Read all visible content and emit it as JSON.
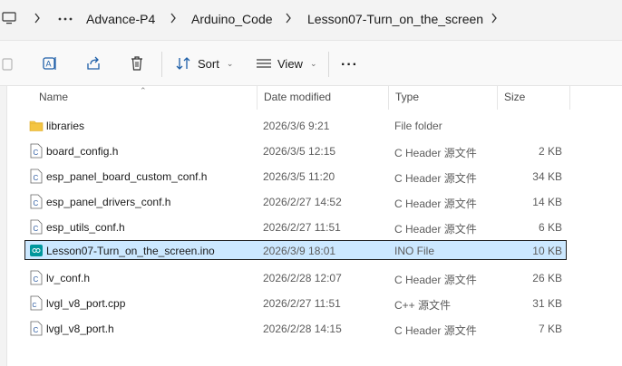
{
  "breadcrumbs": [
    "Advance-P4",
    "Arduino_Code",
    "Lesson07-Turn_on_the_screen"
  ],
  "toolbar": {
    "sort_label": "Sort",
    "view_label": "View",
    "icons": [
      "copy-icon",
      "rename-icon",
      "share-icon",
      "delete-icon",
      "sort-icon",
      "view-icon",
      "more-icon"
    ]
  },
  "columns": {
    "name": "Name",
    "date": "Date modified",
    "type": "Type",
    "size": "Size"
  },
  "files": [
    {
      "name": "libraries",
      "date": "2026/3/6 9:21",
      "type": "File folder",
      "size": "",
      "icon": "folder-icon",
      "selected": false
    },
    {
      "name": "board_config.h",
      "date": "2026/3/5 12:15",
      "type": "C Header 源文件",
      "size": "2 KB",
      "icon": "c-header-file-icon",
      "selected": false
    },
    {
      "name": "esp_panel_board_custom_conf.h",
      "date": "2026/3/5 11:20",
      "type": "C Header 源文件",
      "size": "34 KB",
      "icon": "c-header-file-icon",
      "selected": false
    },
    {
      "name": "esp_panel_drivers_conf.h",
      "date": "2026/2/27 14:52",
      "type": "C Header 源文件",
      "size": "14 KB",
      "icon": "c-header-file-icon",
      "selected": false
    },
    {
      "name": "esp_utils_conf.h",
      "date": "2026/2/27 11:51",
      "type": "C Header 源文件",
      "size": "6 KB",
      "icon": "c-header-file-icon",
      "selected": false
    },
    {
      "name": "Lesson07-Turn_on_the_screen.ino",
      "date": "2026/3/9 18:01",
      "type": "INO File",
      "size": "10 KB",
      "icon": "arduino-file-icon",
      "selected": true
    },
    {
      "name": "lv_conf.h",
      "date": "2026/2/28 12:07",
      "type": "C Header 源文件",
      "size": "26 KB",
      "icon": "c-header-file-icon",
      "selected": false
    },
    {
      "name": "lvgl_v8_port.cpp",
      "date": "2026/2/27 11:51",
      "type": "C++ 源文件",
      "size": "31 KB",
      "icon": "cpp-file-icon",
      "selected": false
    },
    {
      "name": "lvgl_v8_port.h",
      "date": "2026/2/28 14:15",
      "type": "C Header 源文件",
      "size": "7 KB",
      "icon": "c-header-file-icon",
      "selected": false
    }
  ],
  "colors": {
    "selection": "#cce8ff",
    "folder": "#f4c542",
    "arduino": "#00979c"
  }
}
